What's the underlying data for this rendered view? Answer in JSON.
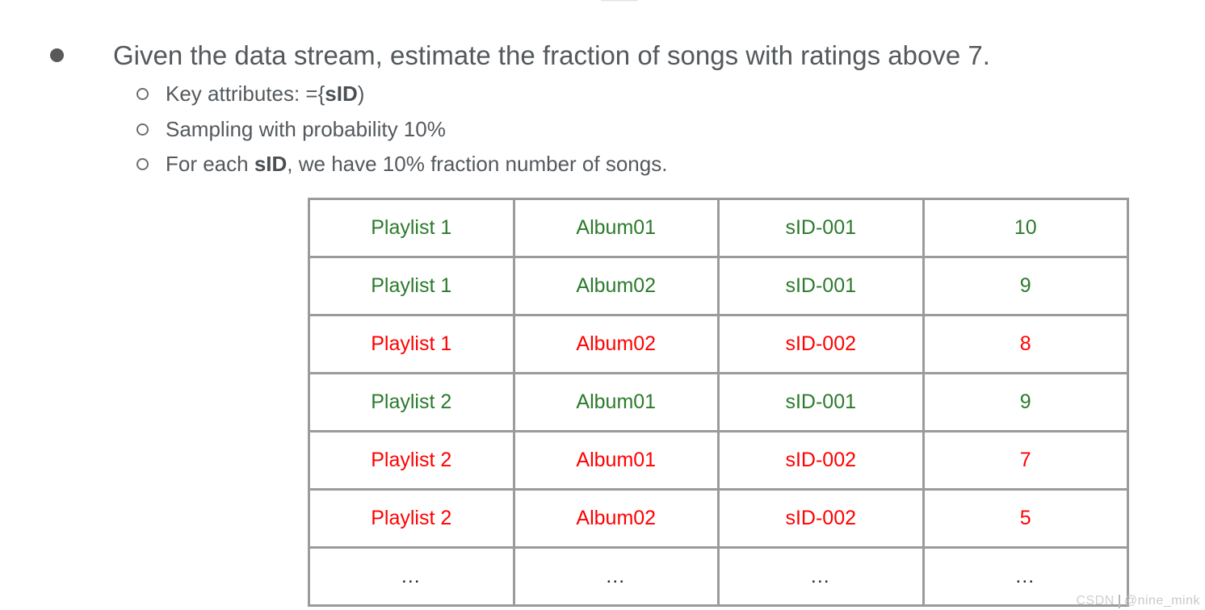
{
  "slide": {
    "main_bullet": "Given the data stream, estimate the fraction of songs with ratings above 7.",
    "sub_bullets": [
      {
        "prefix": "Key attributes: ={",
        "bold": "sID",
        "suffix": ")"
      },
      {
        "prefix": "Sampling with probability 10%",
        "bold": "",
        "suffix": ""
      },
      {
        "prefix": "For each ",
        "bold": "sID",
        "suffix": ", we have 10% fraction number of songs."
      }
    ]
  },
  "table": {
    "rows": [
      {
        "cells": [
          "Playlist 1",
          "Album01",
          "sID-001",
          "10"
        ],
        "state": "green"
      },
      {
        "cells": [
          "Playlist 1",
          "Album02",
          "sID-001",
          "9"
        ],
        "state": "green"
      },
      {
        "cells": [
          "Playlist 1",
          "Album02",
          "sID-002",
          "8"
        ],
        "state": "red"
      },
      {
        "cells": [
          "Playlist 2",
          "Album01",
          "sID-001",
          "9"
        ],
        "state": "green"
      },
      {
        "cells": [
          "Playlist 2",
          "Album01",
          "sID-002",
          "7"
        ],
        "state": "red"
      },
      {
        "cells": [
          "Playlist 2",
          "Album02",
          "sID-002",
          "5"
        ],
        "state": "red"
      },
      {
        "cells": [
          "…",
          "…",
          "…",
          "…"
        ],
        "state": "ellipsis"
      }
    ]
  },
  "watermark": {
    "brand": "CSDN",
    "user": "@nine_mink"
  },
  "colors": {
    "sampled_green": "#2b7a2b",
    "excluded_red": "#ff0000",
    "text_gray": "#54595d",
    "border_gray": "#9b9b9b"
  }
}
